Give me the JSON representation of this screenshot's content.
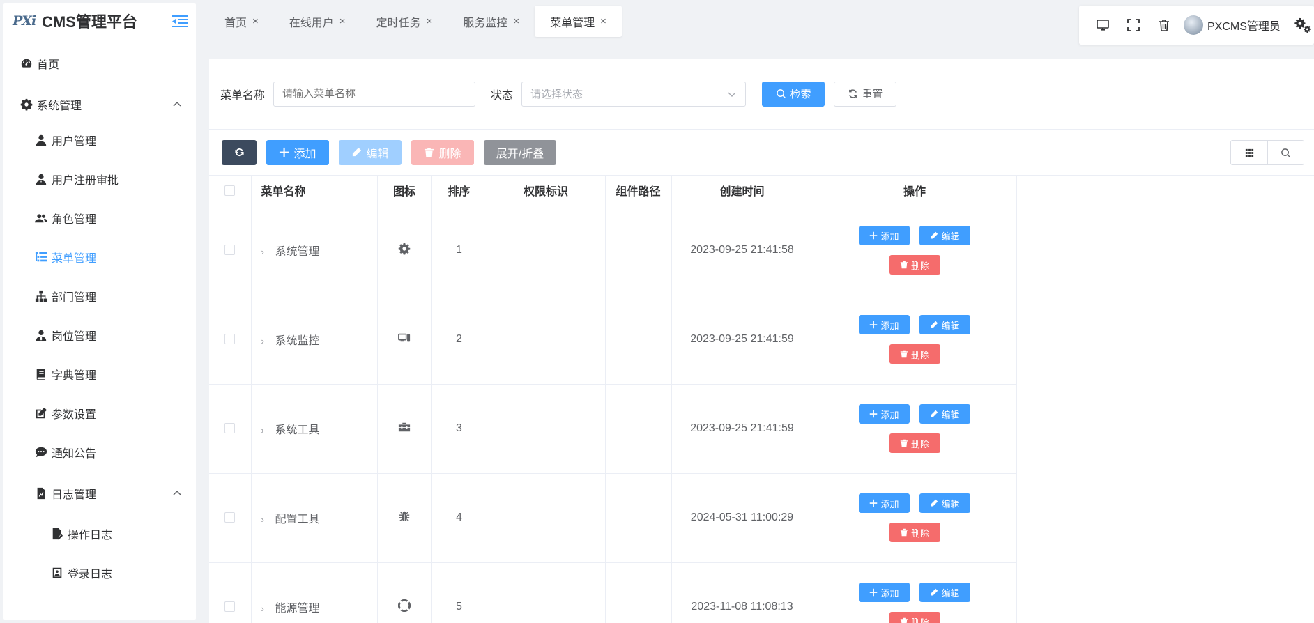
{
  "app": {
    "logo_mark": "PXi",
    "title": "CMS管理平台"
  },
  "sidebar": {
    "items": [
      {
        "label": "首页",
        "icon": "dashboard-icon"
      },
      {
        "label": "系统管理",
        "icon": "gear-icon",
        "expanded": true
      },
      {
        "label": "用户管理",
        "icon": "user-icon"
      },
      {
        "label": "用户注册审批",
        "icon": "user-check-icon"
      },
      {
        "label": "角色管理",
        "icon": "users-icon"
      },
      {
        "label": "菜单管理",
        "icon": "menu-tree-icon",
        "active": true
      },
      {
        "label": "部门管理",
        "icon": "sitemap-icon"
      },
      {
        "label": "岗位管理",
        "icon": "user-tie-icon"
      },
      {
        "label": "字典管理",
        "icon": "book-icon"
      },
      {
        "label": "参数设置",
        "icon": "edit-icon"
      },
      {
        "label": "通知公告",
        "icon": "comments-icon"
      },
      {
        "label": "日志管理",
        "icon": "file-chart-icon",
        "expanded": true
      },
      {
        "label": "操作日志",
        "icon": "file-signature-icon"
      },
      {
        "label": "登录日志",
        "icon": "login-log-icon"
      }
    ]
  },
  "tabs": [
    {
      "label": "首页",
      "close": "×"
    },
    {
      "label": "在线用户",
      "close": "×"
    },
    {
      "label": "定时任务",
      "close": "×"
    },
    {
      "label": "服务监控",
      "close": "×"
    },
    {
      "label": "菜单管理",
      "close": "×",
      "active": true
    }
  ],
  "toolbar": {
    "username": "PXCMS管理员"
  },
  "search": {
    "name_label": "菜单名称",
    "name_placeholder": "请输入菜单名称",
    "status_label": "状态",
    "status_placeholder": "请选择状态",
    "search_btn": "检索",
    "reset_btn": "重置"
  },
  "actions": {
    "add": "添加",
    "edit": "编辑",
    "delete": "删除",
    "toggle": "展开/折叠"
  },
  "table": {
    "headers": [
      "菜单名称",
      "图标",
      "排序",
      "权限标识",
      "组件路径",
      "创建时间",
      "操作"
    ],
    "rows": [
      {
        "name": "系统管理",
        "icon": "gear-icon",
        "order": "1",
        "perm": "",
        "path": "",
        "created": "2023-09-25 21:41:58"
      },
      {
        "name": "系统监控",
        "icon": "monitor-icon",
        "order": "2",
        "perm": "",
        "path": "",
        "created": "2023-09-25 21:41:59"
      },
      {
        "name": "系统工具",
        "icon": "toolbox-icon",
        "order": "3",
        "perm": "",
        "path": "",
        "created": "2023-09-25 21:41:59"
      },
      {
        "name": "配置工具",
        "icon": "bug-icon",
        "order": "4",
        "perm": "",
        "path": "",
        "created": "2024-05-31 11:00:29"
      },
      {
        "name": "能源管理",
        "icon": "lifebuoy-icon",
        "order": "5",
        "perm": "",
        "path": "",
        "created": "2023-11-08 11:08:13"
      }
    ],
    "row_add": "添加",
    "row_edit": "编辑",
    "row_delete": "删除"
  },
  "colors": {
    "primary": "#409eff",
    "danger": "#f56c6c",
    "dark": "#3c4a5e",
    "gray": "#909399"
  }
}
